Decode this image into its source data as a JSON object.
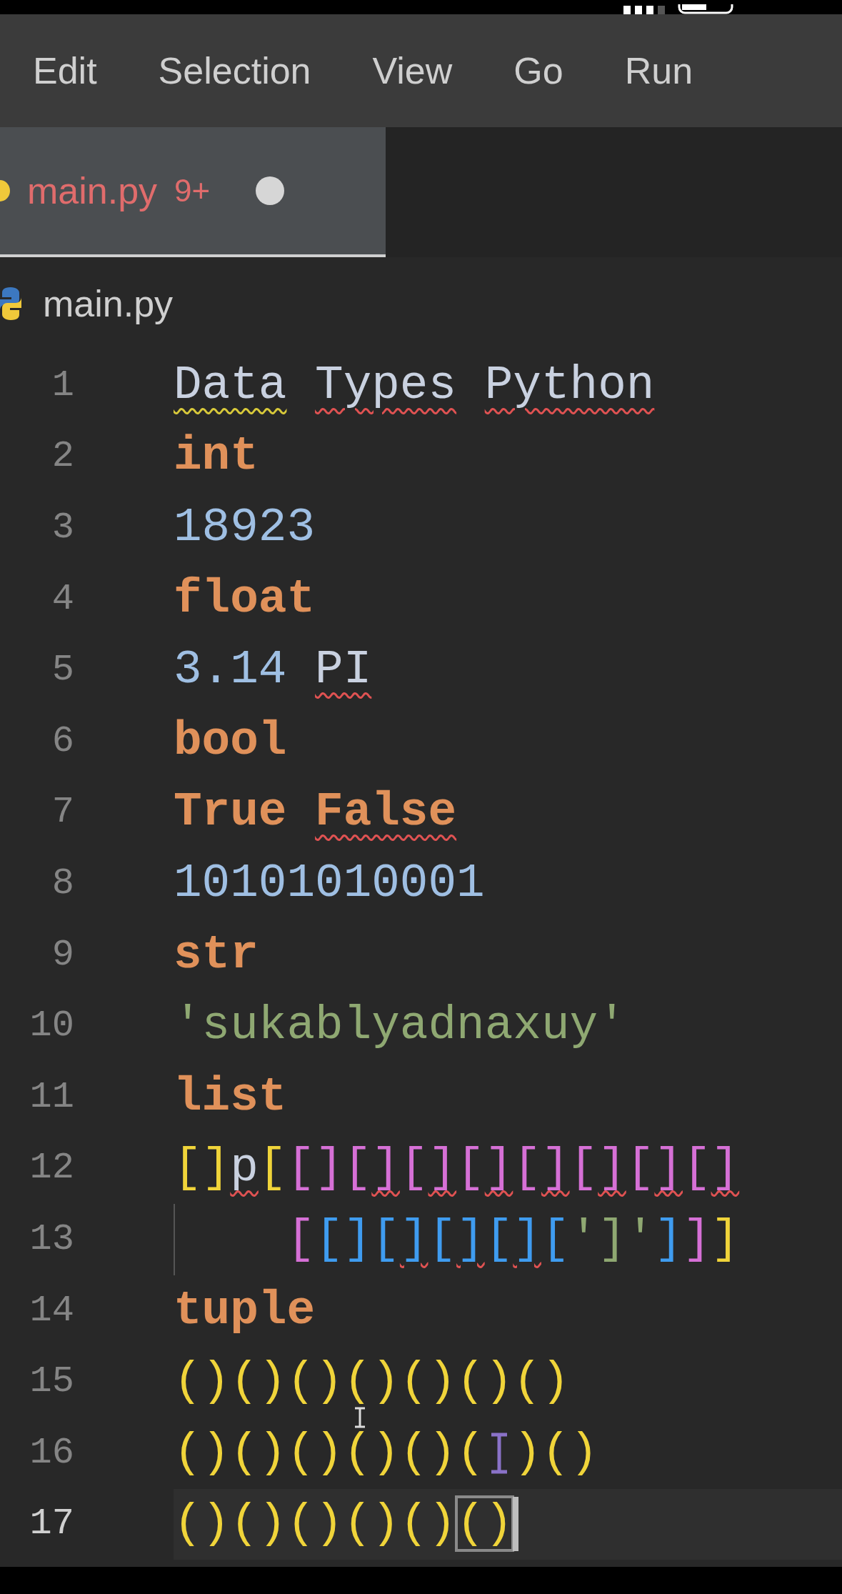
{
  "menu": [
    "Edit",
    "Selection",
    "View",
    "Go",
    "Run"
  ],
  "tab": {
    "label": "main.py",
    "problems": "9+",
    "modified": true,
    "selected": true
  },
  "breadcrumb": "main.py",
  "lines": [
    {
      "number": "1",
      "active": false,
      "tokens": [
        {
          "text": "Data",
          "kind": "plain",
          "warning": true
        },
        {
          "text": " Types",
          "kind": "plain",
          "error": true
        },
        {
          "text": " Python",
          "kind": "plain",
          "error": true
        }
      ]
    },
    {
      "number": "2",
      "active": false,
      "tokens": [
        {
          "text": "int",
          "kind": "keyword"
        }
      ]
    },
    {
      "number": "3",
      "active": false,
      "tokens": [
        {
          "text": "18923",
          "kind": "number"
        }
      ]
    },
    {
      "number": "4",
      "active": false,
      "tokens": [
        {
          "text": "float",
          "kind": "keyword"
        }
      ]
    },
    {
      "number": "5",
      "active": false,
      "tokens": [
        {
          "text": "3.14",
          "kind": "number"
        },
        {
          "text": " PI",
          "kind": "plain",
          "error": true
        }
      ]
    },
    {
      "number": "6",
      "active": false,
      "tokens": [
        {
          "text": "bool",
          "kind": "keyword"
        }
      ]
    },
    {
      "number": "7",
      "active": false,
      "tokens": [
        {
          "text": "True",
          "kind": "keyword"
        },
        {
          "text": " False",
          "kind": "keyword",
          "error": true
        }
      ]
    },
    {
      "number": "8",
      "active": false,
      "tokens": [
        {
          "text": "10101010001",
          "kind": "number"
        }
      ]
    },
    {
      "number": "9",
      "active": false,
      "tokens": [
        {
          "text": "str",
          "kind": "keyword"
        }
      ]
    },
    {
      "number": "10",
      "active": false,
      "tokens": [
        {
          "text": "'sukablyadnaxuy'",
          "kind": "string"
        }
      ]
    },
    {
      "number": "11",
      "active": false,
      "tokens": [
        {
          "text": "list",
          "kind": "keyword"
        }
      ]
    },
    {
      "number": "12",
      "active": false,
      "tokens": [
        {
          "text": "[]",
          "kind": "b1"
        },
        {
          "text": "p",
          "kind": "plain",
          "error": true
        },
        {
          "text": "[",
          "kind": "b1"
        },
        {
          "text": "[]",
          "kind": "b2"
        },
        {
          "text": "[",
          "kind": "b2"
        },
        {
          "text": "]",
          "kind": "b2",
          "error": true
        },
        {
          "text": "[",
          "kind": "b2"
        },
        {
          "text": "]",
          "kind": "b2",
          "error": true
        },
        {
          "text": "[",
          "kind": "b2"
        },
        {
          "text": "]",
          "kind": "b2",
          "error": true
        },
        {
          "text": "[",
          "kind": "b2"
        },
        {
          "text": "]",
          "kind": "b2",
          "error": true
        },
        {
          "text": "[",
          "kind": "b2"
        },
        {
          "text": "]",
          "kind": "b2",
          "error": true
        },
        {
          "text": "[",
          "kind": "b2"
        },
        {
          "text": "]",
          "kind": "b2",
          "error": true
        },
        {
          "text": "[",
          "kind": "b2"
        },
        {
          "text": "]",
          "kind": "b2",
          "error": true
        }
      ]
    },
    {
      "number": "13",
      "active": false,
      "indent_guide": true,
      "tokens": [
        {
          "text": "    [",
          "kind": "b2"
        },
        {
          "text": "[]",
          "kind": "b3"
        },
        {
          "text": "[",
          "kind": "b3"
        },
        {
          "text": "]",
          "kind": "b3",
          "error": true
        },
        {
          "text": "[",
          "kind": "b3"
        },
        {
          "text": "]",
          "kind": "b3",
          "error": true
        },
        {
          "text": "[",
          "kind": "b3"
        },
        {
          "text": "]",
          "kind": "b3",
          "error": true
        },
        {
          "text": "[",
          "kind": "b3"
        },
        {
          "text": "']'",
          "kind": "string"
        },
        {
          "text": "]",
          "kind": "b3"
        },
        {
          "text": "]",
          "kind": "b2"
        },
        {
          "text": "]",
          "kind": "b1"
        }
      ]
    },
    {
      "number": "14",
      "active": false,
      "tokens": [
        {
          "text": "tuple",
          "kind": "keyword"
        }
      ]
    },
    {
      "number": "15",
      "active": false,
      "tokens": [
        {
          "text": "()()()()()()()",
          "kind": "b1"
        }
      ]
    },
    {
      "number": "16",
      "active": false,
      "tokens": [
        {
          "text": "()()()()()(",
          "kind": "b1"
        },
        {
          "kind": "ibeam"
        },
        {
          "text": ")()",
          "kind": "b1"
        }
      ]
    },
    {
      "number": "17",
      "active": true,
      "tokens": [
        {
          "text": "()()()()()",
          "kind": "b1"
        },
        {
          "text": "()",
          "kind": "b1",
          "match": true
        }
      ]
    }
  ]
}
